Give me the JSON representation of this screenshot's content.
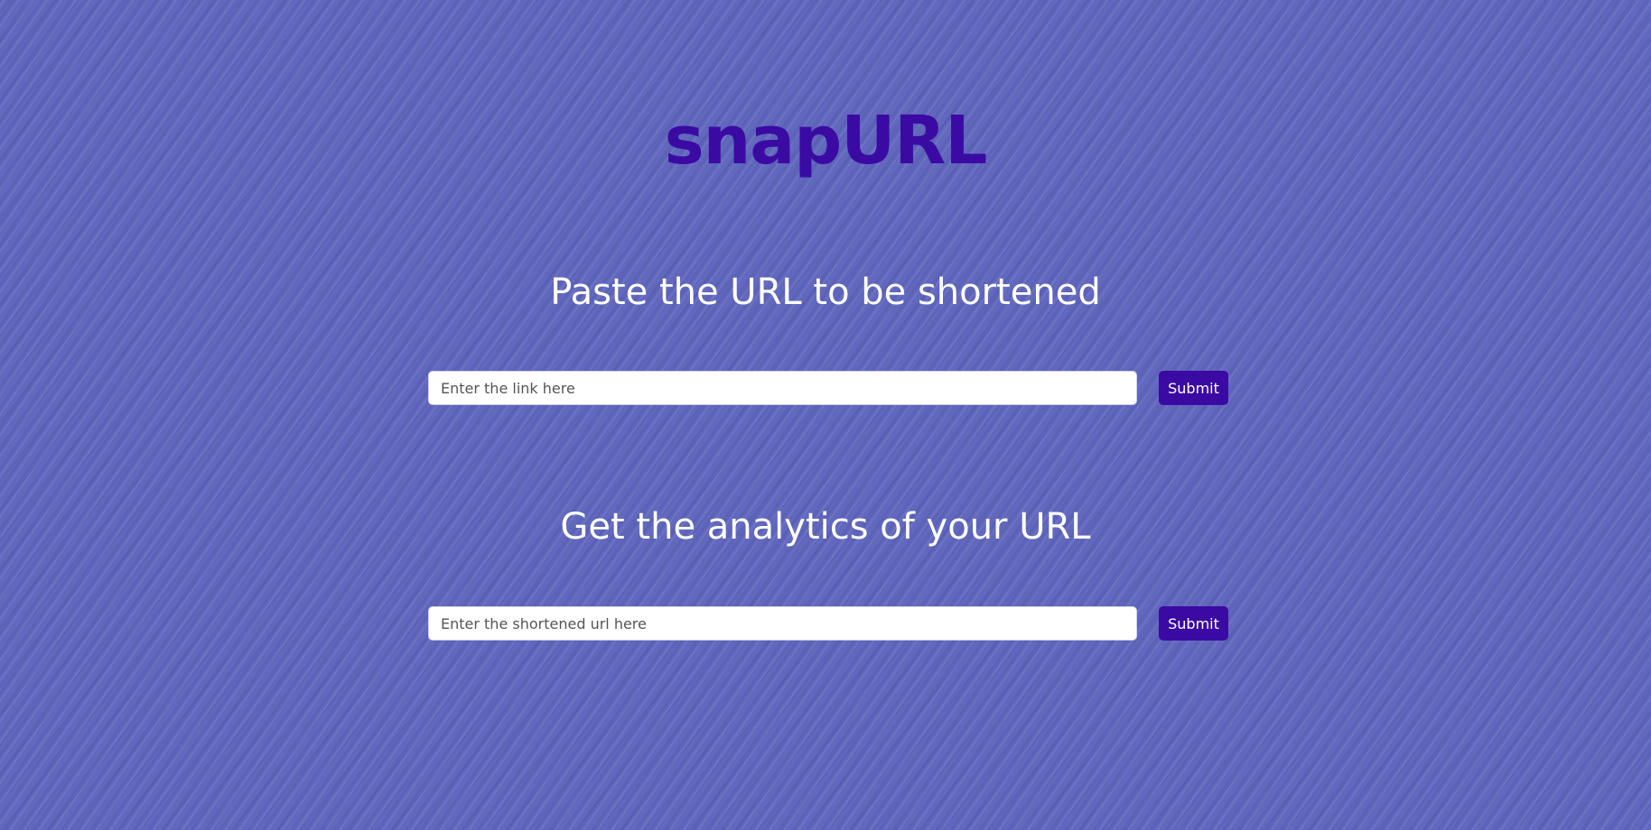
{
  "app": {
    "logo_text": "snapURL",
    "logo_color": "#3b0aa3",
    "background_color": "#6168bd"
  },
  "shorten": {
    "heading": "Paste the URL to be shortened",
    "input_placeholder": "Enter the link here",
    "input_value": "",
    "submit_label": "Submit"
  },
  "analytics": {
    "heading": "Get the analytics of your URL",
    "input_placeholder": "Enter the shortened url here",
    "input_value": "",
    "submit_label": "Submit"
  }
}
